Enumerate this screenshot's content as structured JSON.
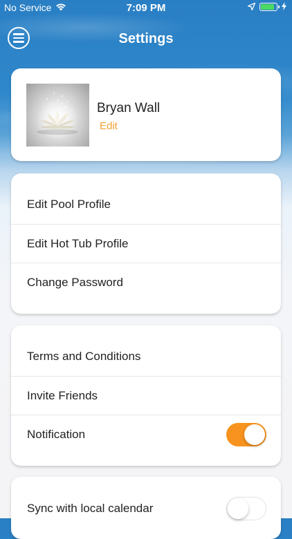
{
  "status_bar": {
    "carrier": "No Service",
    "time": "7:09 PM",
    "battery_color": "#4cd964"
  },
  "header": {
    "title": "Settings",
    "menu_icon": "hamburger-circle-icon"
  },
  "profile": {
    "name": "Bryan Wall",
    "edit_label": "Edit"
  },
  "sections": [
    {
      "items": [
        {
          "label": "Edit Pool Profile"
        },
        {
          "label": "Edit Hot Tub Profile"
        },
        {
          "label": "Change Password"
        }
      ]
    },
    {
      "items": [
        {
          "label": "Terms and Conditions"
        },
        {
          "label": "Invite Friends"
        },
        {
          "label": "Notification",
          "toggle": true
        }
      ]
    },
    {
      "items": [
        {
          "label": "Sync with local calendar",
          "toggle": false
        }
      ]
    }
  ],
  "colors": {
    "accent": "#f7931e",
    "edit_link": "#f0a030",
    "header_blue": "#2a7fc4"
  }
}
